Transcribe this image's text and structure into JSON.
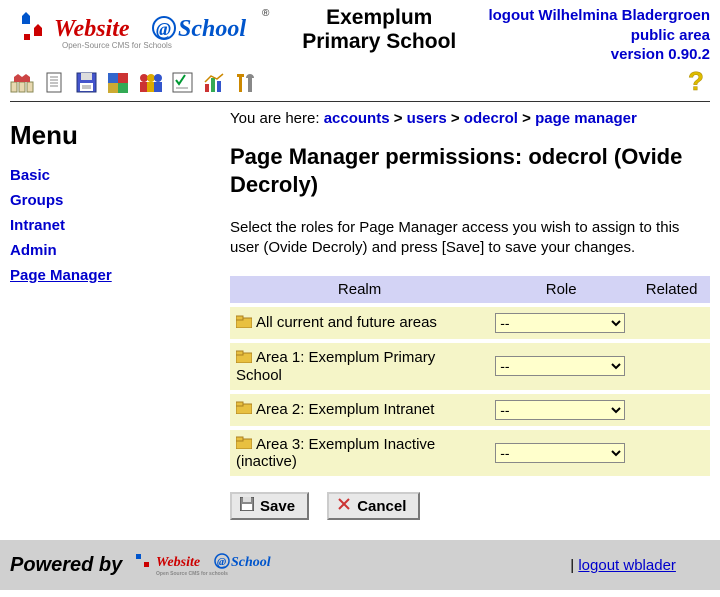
{
  "header": {
    "school_line1": "Exemplum",
    "school_line2": "Primary School",
    "logout_label": "logout Wilhelmina Bladergroen",
    "public_area": "public area",
    "version": "version 0.90.2"
  },
  "sidebar": {
    "title": "Menu",
    "items": [
      {
        "label": "Basic",
        "active": false
      },
      {
        "label": "Groups",
        "active": false
      },
      {
        "label": "Intranet",
        "active": false
      },
      {
        "label": "Admin",
        "active": false
      },
      {
        "label": "Page Manager",
        "active": true
      }
    ]
  },
  "breadcrumb": {
    "prefix": "You are here: ",
    "parts": [
      "accounts",
      "users",
      "odecrol",
      "page manager"
    ]
  },
  "main": {
    "heading": "Page Manager permissions: odecrol (Ovide Decroly)",
    "description": "Select the roles for Page Manager access you wish to assign to this user (Ovide Decroly) and press [Save] to save your changes."
  },
  "table": {
    "headers": {
      "realm": "Realm",
      "role": "Role",
      "related": "Related"
    },
    "rows": [
      {
        "realm": "All current and future areas",
        "role": "--"
      },
      {
        "realm": "Area 1: Exemplum Primary School",
        "role": "--"
      },
      {
        "realm": "Area 2: Exemplum Intranet",
        "role": "--"
      },
      {
        "realm": "Area 3: Exemplum Inactive (inactive)",
        "role": "--"
      }
    ]
  },
  "buttons": {
    "save": "Save",
    "cancel": "Cancel"
  },
  "footer": {
    "powered": "Powered by",
    "logout_link": "logout wblader"
  }
}
